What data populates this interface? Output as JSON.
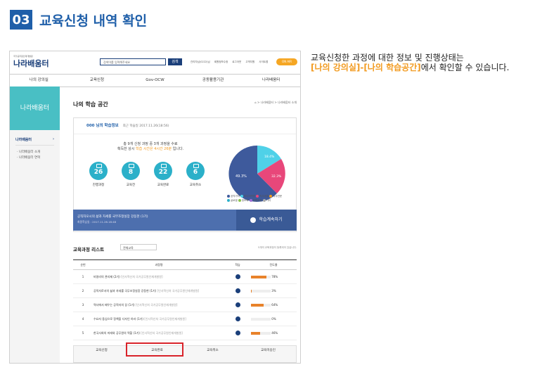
{
  "step": {
    "num": "03",
    "title": "교육신청 내역 확인"
  },
  "desc": {
    "line1": "교육신청한 과정에 대한 정보 및 진행상태는",
    "hl": "[나의 강의실]-[나의 학습공간]",
    "line2": "에서 확인할 수 있습니다."
  },
  "site": {
    "logo_small": "국가공무원인재개발원",
    "logo": "나라배움터",
    "search_placeholder": "검색어를 입력해주세요",
    "search_btn": "검색",
    "top_links": [
      "관리자님(0222)님",
      "회원정보수정",
      "로그아웃",
      "고객지원",
      "사이트맵"
    ],
    "onair": "ON AIR",
    "gnb": [
      "나의 강의실",
      "교육신청",
      "Gov-OCW",
      "공동활용기관",
      "나라배움터"
    ],
    "lnb_head": "나라배움터",
    "lnb_item": "나라배움터",
    "lnb_subs": [
      "· 나라배움터 소개",
      "· 나라배움터 연혁"
    ],
    "page_title": "나의 학습 공간",
    "breadcrumb": "⌂ > 나라배움터 > 나라배움터 소개",
    "card": {
      "user": "000 님의 학습정보",
      "recent": "최근 학습일 2017.11.26(18:56)",
      "summary1": "총 9개 신청 과정 중 3개 과정을 수료",
      "summary2a": "획득한 상시 ",
      "summary2b": "학습 시간은 4시간 26분",
      "summary2c": " 입니다.",
      "circles": [
        {
          "value": "26",
          "label": "진행과정"
        },
        {
          "value": "8",
          "label": "교육전"
        },
        {
          "value": "22",
          "label": "교육완료"
        },
        {
          "value": "6",
          "label": "교육취소"
        }
      ],
      "pie_labels": [
        "49.3%",
        "18.4%",
        "32.3%"
      ],
      "legend": [
        "공직가치",
        "미디어역량",
        "직무공통",
        "직무전문",
        "글로벌",
        "정보화",
        "전문소양",
        "기타"
      ],
      "banner_title": "공직자오시의 삶과 자세를 국무조정실장 강동현 (1기)",
      "banner_date": "최종학습일 : 2017.11.26.18:48",
      "banner_btn": "학습계속하기"
    },
    "list": {
      "title": "교육과정 리스트",
      "select": "전체교육",
      "note": "5개의 교육과정이 등록되어 있습니다.",
      "headers": [
        "순번",
        "과정명",
        "학습",
        "진도율"
      ],
      "rows": [
        {
          "no": "1",
          "name": "비영리의 관리제 (2기)",
          "sub": "[인사혁신처 국가공무원인재개발원]",
          "progress": "78%"
        },
        {
          "no": "2",
          "name": "공직자로서의 삶과 자세를 국무조정실장 강동현 (1기)",
          "sub": "[인사혁신처 국가공무원인재개발원]",
          "progress": "3%"
        },
        {
          "no": "3",
          "name": "역사에서 배우는 공직자의 길 (1기)",
          "sub": "[인사혁신처 국가공무원인재개발원]",
          "progress": "64%"
        },
        {
          "no": "4",
          "name": "수요자 중심으로 정책을 디자인 하라 (1기)",
          "sub": "[인사혁신처 국가공무원인재개발원]",
          "progress": "0%"
        },
        {
          "no": "5",
          "name": "한국사회의 미래와 공무원의 역할 (1기)",
          "sub": "[인사혁신처 국가공무원인재개발원]",
          "progress": "46%"
        }
      ]
    },
    "tabs": [
      "교육신청",
      "교육완료",
      "교육취소",
      "교육미승인"
    ]
  },
  "colors": {
    "accent": "#1f5fa9",
    "highlight": "#f29a1f",
    "teal": "#2bb0c9",
    "red_box": "#d9232a"
  },
  "progress_values": [
    0.78,
    0.03,
    0.64,
    0.0,
    0.46
  ]
}
